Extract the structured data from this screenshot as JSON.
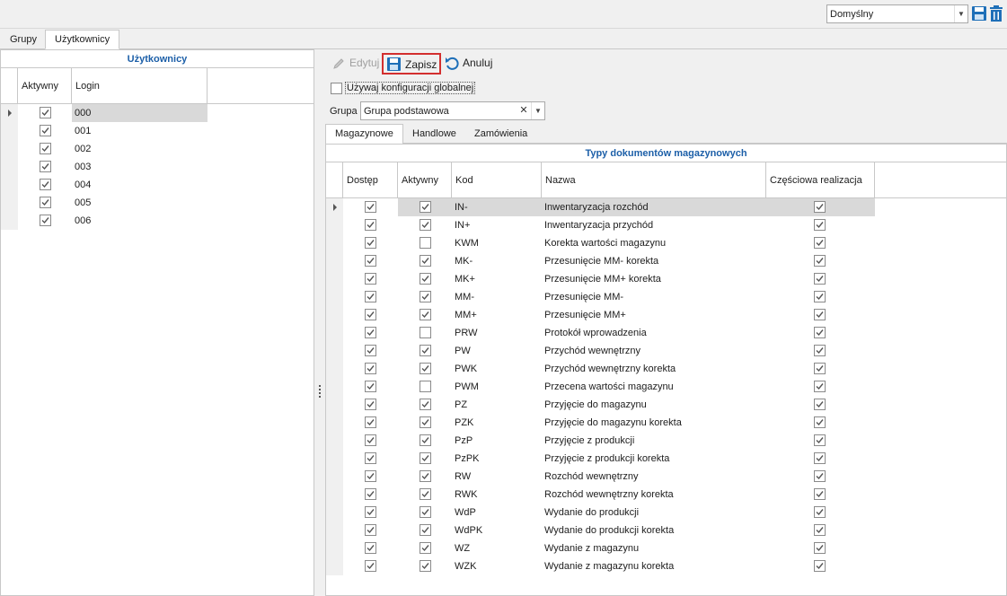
{
  "topbar": {
    "layout_value": "Domyślny",
    "save_icon": "save-icon",
    "delete_icon": "trash-icon"
  },
  "tabs": [
    {
      "label": "Grupy",
      "active": false
    },
    {
      "label": "Użytkownicy",
      "active": true
    }
  ],
  "users_grid": {
    "title": "Użytkownicy",
    "columns": [
      "Aktywny",
      "Login"
    ],
    "rows": [
      {
        "active": true,
        "login": "000"
      },
      {
        "active": true,
        "login": "001"
      },
      {
        "active": true,
        "login": "002"
      },
      {
        "active": true,
        "login": "003"
      },
      {
        "active": true,
        "login": "004"
      },
      {
        "active": true,
        "login": "005"
      },
      {
        "active": true,
        "login": "006"
      }
    ]
  },
  "toolbar": {
    "edit_label": "Edytuj",
    "save_label": "Zapisz",
    "cancel_label": "Anuluj"
  },
  "config": {
    "global_label": "Używaj konfiguracji globalnej",
    "global_checked": false,
    "group_label": "Grupa",
    "group_value": "Grupa podstawowa"
  },
  "subtabs": [
    {
      "label": "Magazynowe",
      "active": true
    },
    {
      "label": "Handlowe",
      "active": false
    },
    {
      "label": "Zamówienia",
      "active": false
    }
  ],
  "doc_grid": {
    "title": "Typy dokumentów magazynowych",
    "columns": [
      "Dostęp",
      "Aktywny",
      "Kod",
      "Nazwa",
      "Częściowa realizacja"
    ],
    "rows": [
      {
        "access": true,
        "active": true,
        "code": "IN-",
        "name": "Inwentaryzacja rozchód",
        "partial": true
      },
      {
        "access": true,
        "active": true,
        "code": "IN+",
        "name": "Inwentaryzacja przychód",
        "partial": true
      },
      {
        "access": true,
        "active": false,
        "code": "KWM",
        "name": "Korekta wartości magazynu",
        "partial": true
      },
      {
        "access": true,
        "active": true,
        "code": "MK-",
        "name": "Przesunięcie MM- korekta",
        "partial": true
      },
      {
        "access": true,
        "active": true,
        "code": "MK+",
        "name": "Przesunięcie MM+ korekta",
        "partial": true
      },
      {
        "access": true,
        "active": true,
        "code": "MM-",
        "name": "Przesunięcie MM-",
        "partial": true
      },
      {
        "access": true,
        "active": true,
        "code": "MM+",
        "name": "Przesunięcie MM+",
        "partial": true
      },
      {
        "access": true,
        "active": false,
        "code": "PRW",
        "name": "Protokół wprowadzenia",
        "partial": true
      },
      {
        "access": true,
        "active": true,
        "code": "PW",
        "name": "Przychód wewnętrzny",
        "partial": true
      },
      {
        "access": true,
        "active": true,
        "code": "PWK",
        "name": "Przychód wewnętrzny korekta",
        "partial": true
      },
      {
        "access": true,
        "active": false,
        "code": "PWM",
        "name": "Przecena wartości magazynu",
        "partial": true
      },
      {
        "access": true,
        "active": true,
        "code": "PZ",
        "name": "Przyjęcie do magazynu",
        "partial": true
      },
      {
        "access": true,
        "active": true,
        "code": "PZK",
        "name": "Przyjęcie do magazynu korekta",
        "partial": true
      },
      {
        "access": true,
        "active": true,
        "code": "PzP",
        "name": "Przyjęcie z produkcji",
        "partial": true
      },
      {
        "access": true,
        "active": true,
        "code": "PzPK",
        "name": "Przyjęcie z produkcji korekta",
        "partial": true
      },
      {
        "access": true,
        "active": true,
        "code": "RW",
        "name": "Rozchód wewnętrzny",
        "partial": true
      },
      {
        "access": true,
        "active": true,
        "code": "RWK",
        "name": "Rozchód wewnętrzny korekta",
        "partial": true
      },
      {
        "access": true,
        "active": true,
        "code": "WdP",
        "name": "Wydanie do produkcji",
        "partial": true
      },
      {
        "access": true,
        "active": true,
        "code": "WdPK",
        "name": "Wydanie do produkcji korekta",
        "partial": true
      },
      {
        "access": true,
        "active": true,
        "code": "WZ",
        "name": "Wydanie z magazynu",
        "partial": true
      },
      {
        "access": true,
        "active": true,
        "code": "WZK",
        "name": "Wydanie z magazynu korekta",
        "partial": true
      }
    ]
  }
}
